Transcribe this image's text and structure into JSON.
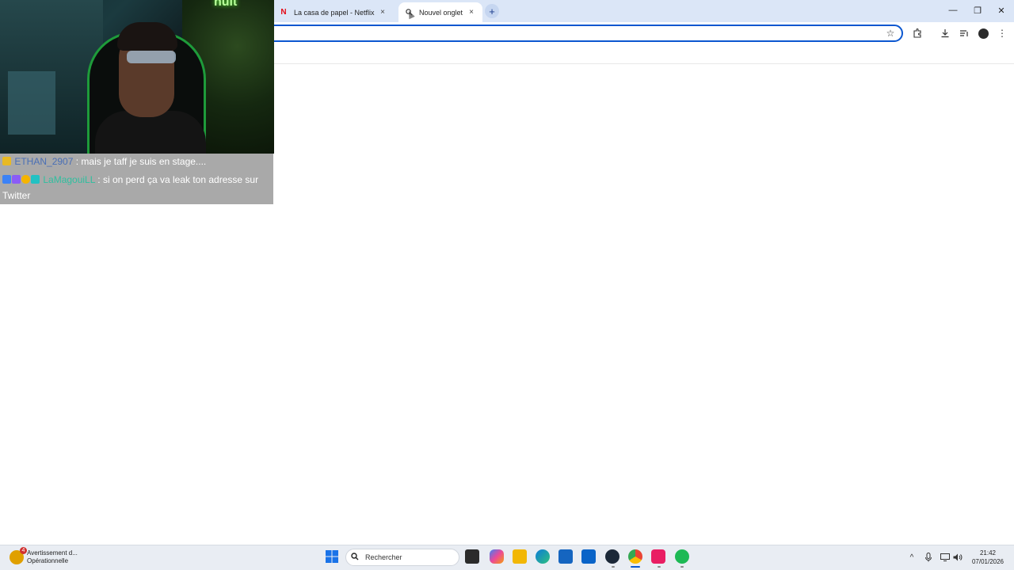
{
  "browser": {
    "tabs": [
      {
        "label": "La casa de papel - Netflix",
        "favicon": "netflix-icon",
        "active": false
      },
      {
        "label": "Nouvel onglet",
        "favicon": "search-icon",
        "active": true
      }
    ],
    "new_tab_symbol": "+",
    "close_symbol": "×",
    "window_controls": {
      "minimize": "—",
      "restore": "❐",
      "close": "✕"
    },
    "address_value": "",
    "toolbar_icons": [
      "bookmark-star-icon",
      "extensions-icon",
      "download-icon",
      "media-control-icon",
      "profile-avatar-icon",
      "menu-icon"
    ]
  },
  "stream_overlay": {
    "neon_text": "nuit",
    "chat": [
      {
        "username": "ETHAN_2907",
        "message": " : mais je taff je suis en stage....",
        "username_color": "#4a6fb5"
      },
      {
        "username": "LaMagouiLL",
        "message": " : si on perd ça va leak ton adresse sur Twitter",
        "username_color": "#2fbf9f"
      }
    ]
  },
  "taskbar": {
    "weather": {
      "badge": "4",
      "title": "Avertissement d...",
      "subtitle": "Opérationnelle"
    },
    "search_placeholder": "Rechercher",
    "apps": [
      "windows-start-icon",
      "task-view-icon",
      "copilot-icon",
      "file-explorer-icon",
      "edge-icon",
      "store-icon",
      "outlook-icon",
      "steam-icon",
      "chrome-icon",
      "tiktok-icon",
      "spotify-icon"
    ],
    "tray": {
      "chevron": "^",
      "time": "21:42",
      "date": "07/01/2026"
    }
  },
  "colors": {
    "accent": "#0b57d0",
    "tabstrip": "#dbe6f7",
    "netflix_red": "#e50914",
    "spotify_green": "#1db954"
  }
}
